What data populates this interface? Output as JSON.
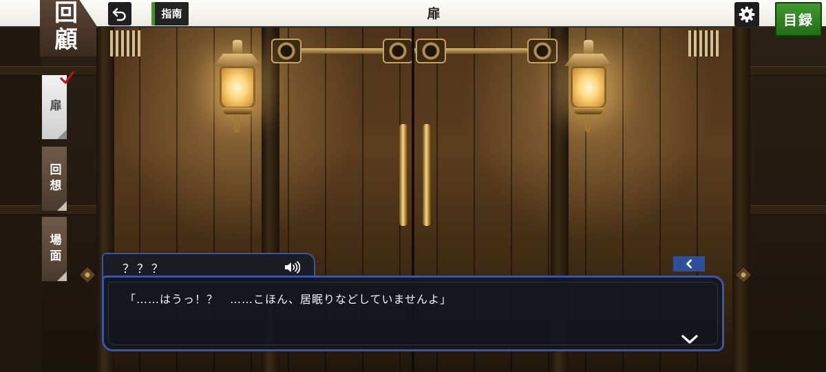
{
  "topbar": {
    "chapter_title": "扉",
    "guide_label": "指南",
    "index_label": "目録",
    "back_icon": "undo-icon",
    "settings_icon": "gear-icon"
  },
  "side": {
    "title": "回顧",
    "tabs": [
      {
        "label": "扉",
        "active": true
      },
      {
        "label": "回想",
        "active": false
      },
      {
        "label": "場面",
        "active": false
      }
    ]
  },
  "dialogue": {
    "speaker": "？？？",
    "text": "「……はうっ！？　……こほん、居眠りなどしていませんよ」",
    "voice_icon": "speaker-icon",
    "log_icon": "chevron-left-icon",
    "next_icon": "chevron-down-icon"
  },
  "colors": {
    "accent_blue": "#3a56a8",
    "index_green": "#2f8a22",
    "side_brown": "#4a3a2c"
  }
}
